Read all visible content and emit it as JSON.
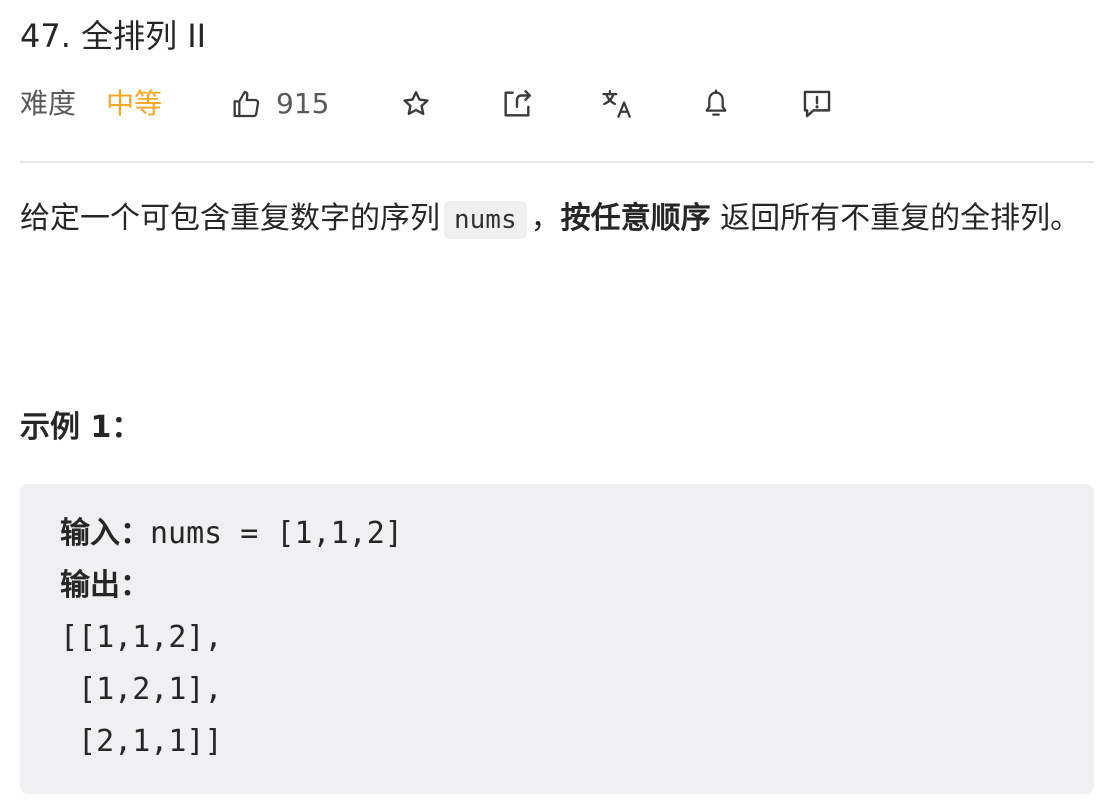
{
  "problem": {
    "title": "47. 全排列 II",
    "difficulty_label": "难度",
    "difficulty": "中等",
    "difficulty_color": "#f5a623",
    "likes": "915"
  },
  "toolbar": {
    "icons": [
      "thumbs-up-icon",
      "star-icon",
      "share-icon",
      "translate-icon",
      "bell-icon",
      "feedback-icon"
    ]
  },
  "description": {
    "part1": "给定一个可包含重复数字的序列",
    "code": "nums",
    "part2": "，",
    "bold": "按任意顺序",
    "part3": " 返回所有不重复的全排列。"
  },
  "example": {
    "title": "示例 1：",
    "input_label": "输入：",
    "input_value": "nums = [1,1,2]",
    "output_label": "输出：",
    "output_lines": [
      "[[1,1,2],",
      " [1,2,1],",
      " [2,1,1]]"
    ]
  }
}
